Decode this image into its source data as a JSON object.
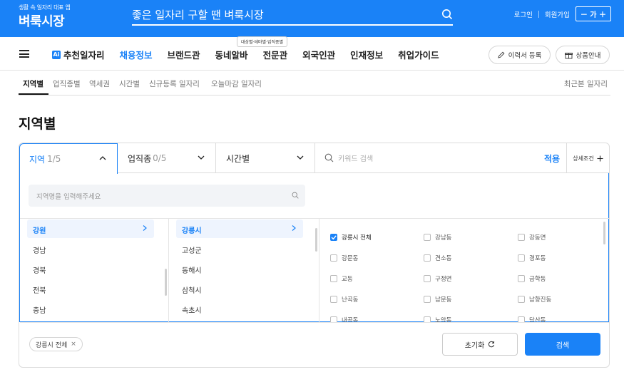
{
  "header": {
    "logo_tagline": "생활 속 일자리 대표 앱",
    "logo_name": "벼룩시장",
    "search_query": "좋은 일자리 구할 땐 벼룩시장",
    "login": "로그인",
    "signup": "회원가입",
    "font_size": "－ 가 ＋"
  },
  "nav": {
    "items": [
      "추천일자리",
      "채용정보",
      "브랜드관",
      "동네알바",
      "전문관",
      "외국인관",
      "인재정보",
      "취업가이드"
    ],
    "ai_badge": "Ai",
    "active_index": 1,
    "tooltip": "대상별·테마별·업직종별",
    "resume_button": "이력서 등록",
    "product_button": "상품안내"
  },
  "subtabs": {
    "items": [
      "지역별",
      "업직종별",
      "역세권",
      "시간별",
      "신규등록 일자리",
      "오늘마감 일자리"
    ],
    "recent": "최근본 일자리"
  },
  "page_title": "지역별",
  "filter": {
    "tab_region": "지역",
    "tab_region_count": "1/5",
    "tab_job": "업직종",
    "tab_job_count": "0/5",
    "tab_time": "시간별",
    "keyword_placeholder": "키워드 검색",
    "apply": "적용",
    "detail": "상세조건",
    "region_search_placeholder": "지역명을 입력해주세요",
    "provinces": [
      "강원",
      "경남",
      "경북",
      "전북",
      "충남"
    ],
    "cities": [
      "강릉시",
      "고성군",
      "동해시",
      "삼척시",
      "속초시"
    ],
    "districts": [
      [
        "강릉시 전체",
        "강남동",
        "강동면"
      ],
      [
        "강문동",
        "견소동",
        "경포동"
      ],
      [
        "교동",
        "구정면",
        "금학동"
      ],
      [
        "난곡동",
        "남문동",
        "남항진동"
      ],
      [
        "내곡동",
        "노암동",
        "담산동"
      ]
    ],
    "selected_chip": "강릉시 전체",
    "chip_remove": "×",
    "reset": "초기화",
    "search": "검색"
  },
  "colors": {
    "accent": "#1a82f7"
  }
}
